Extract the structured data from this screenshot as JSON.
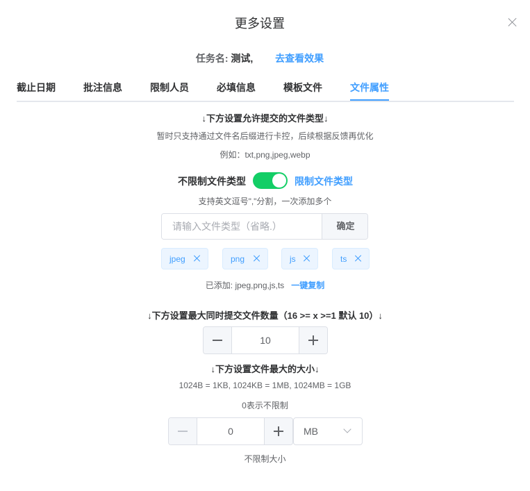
{
  "dialog": {
    "title": "更多设置",
    "close_icon": "close-icon"
  },
  "task": {
    "label": "任务名:",
    "name": "测试,",
    "preview_link": "去查看效果"
  },
  "tabs": [
    {
      "label": "截止日期"
    },
    {
      "label": "批注信息"
    },
    {
      "label": "限制人员"
    },
    {
      "label": "必填信息"
    },
    {
      "label": "模板文件"
    },
    {
      "label": "文件属性",
      "active": true
    }
  ],
  "filetype": {
    "heading": "↓下方设置允许提交的文件类型↓",
    "note": "暂时只支持通过文件名后缀进行卡控，后续根据反馈再优化",
    "example": "例如：txt,png,jpeg,webp",
    "switch_off_label": "不限制文件类型",
    "switch_on_label": "限制文件类型",
    "switch_state": "on",
    "comma_hint": "支持英文逗号\",\"分割，一次添加多个",
    "input_placeholder": "请输入文件类型（省略.）",
    "input_value": "",
    "confirm_label": "确定",
    "tags": [
      "jpeg",
      "png",
      "js",
      "ts"
    ],
    "added_text": "已添加: jpeg,png,js,ts",
    "copy_label": "一键复制"
  },
  "count": {
    "heading": "↓下方设置最大同时提交文件数量（16 >= x >=1 默认 10）↓",
    "value": "10"
  },
  "size": {
    "heading": "↓下方设置文件最大的大小↓",
    "units_note": "1024B = 1KB, 1024KB = 1MB, 1024MB = 1GB",
    "zero_note": "0表示不限制",
    "value": "0",
    "unit": "MB",
    "status": "不限制大小"
  },
  "colors": {
    "accent": "#409eff",
    "switch_on": "#13ce66"
  }
}
